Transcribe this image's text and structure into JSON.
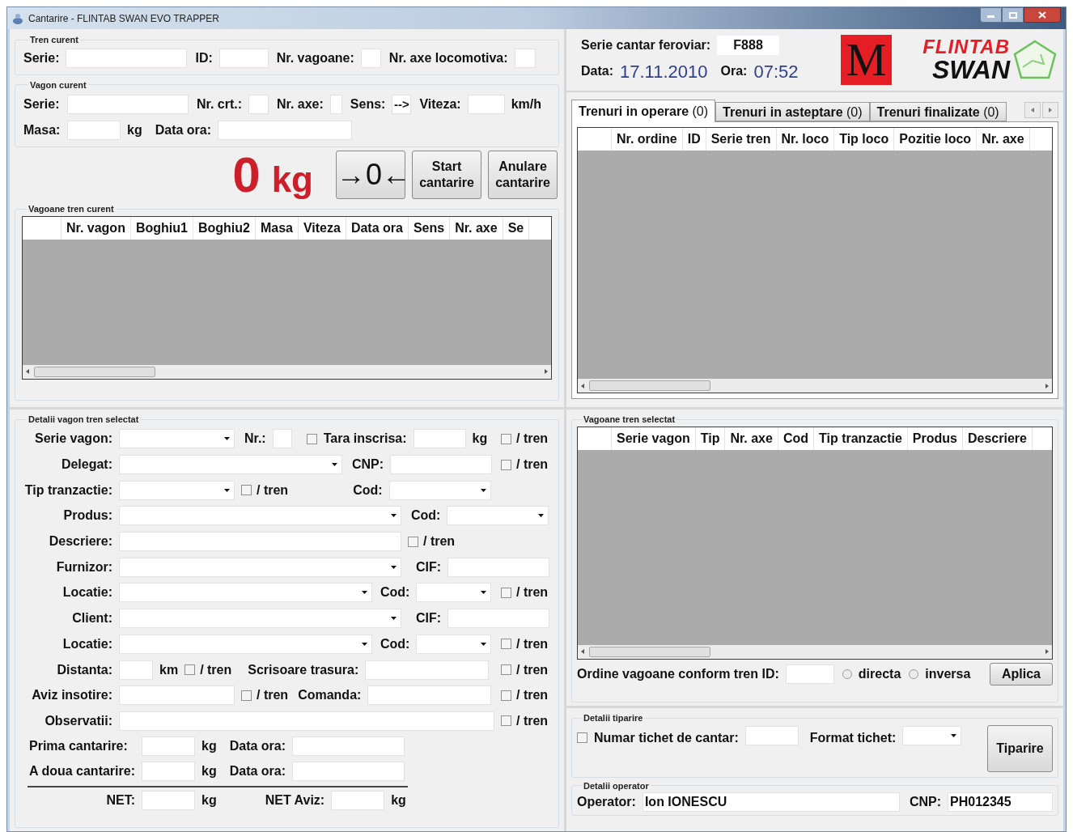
{
  "window": {
    "title": "Cantarire - FLINTAB SWAN EVO TRAPPER"
  },
  "tren_curent": {
    "title": "Tren curent",
    "rows": [
      [
        {
          "kind": "label",
          "text": "Serie:"
        },
        {
          "kind": "field"
        },
        {
          "kind": "label",
          "text": "ID:"
        },
        {
          "kind": "field"
        },
        {
          "kind": "label",
          "text": "Nr. vagoane:"
        },
        {
          "kind": "field"
        },
        {
          "kind": "label",
          "text": "Nr. axe locomotiva:"
        },
        {
          "kind": "field"
        }
      ]
    ]
  },
  "vagon_curent": {
    "title": "Vagon curent",
    "rows": [
      [
        {
          "kind": "label",
          "text": "Serie:"
        },
        {
          "kind": "field"
        },
        {
          "kind": "label",
          "text": "Nr. crt.:"
        },
        {
          "kind": "field"
        },
        {
          "kind": "label",
          "text": "Nr. axe:"
        },
        {
          "kind": "field"
        },
        {
          "kind": "label",
          "text": "Sens:"
        },
        {
          "kind": "field",
          "value": "-->"
        },
        {
          "kind": "label",
          "text": "Viteza:"
        },
        {
          "kind": "field"
        },
        {
          "kind": "unit",
          "text": "km/h"
        }
      ],
      [
        {
          "kind": "label",
          "text": "Masa:"
        },
        {
          "kind": "field"
        },
        {
          "kind": "unit",
          "text": "kg"
        },
        {
          "kind": "label",
          "text": "Data ora:"
        },
        {
          "kind": "field"
        }
      ]
    ]
  },
  "cantarire": {
    "value": "0",
    "unit": "kg",
    "buttons": [
      {
        "kind": "zero",
        "label": "→0←"
      },
      {
        "kind": "action",
        "label": "Start cantarire"
      },
      {
        "kind": "action",
        "label": "Anulare cantarire"
      }
    ]
  },
  "vagoane_tren_curent": {
    "title": "Vagoane tren curent",
    "columns": [
      "Nr. vagon",
      "Boghiu1",
      "Boghiu2",
      "Masa",
      "Viteza",
      "Data ora",
      "Sens",
      "Nr. axe",
      "Se"
    ]
  },
  "cantar": {
    "serie_label": "Serie cantar feroviar:",
    "serie": "F888",
    "data_label": "Data:",
    "data": "17.11.2010",
    "ora_label": "Ora:",
    "ora": "07:52"
  },
  "brand": {
    "mark": "M",
    "line_1": "FLINTAB",
    "line_2": "SWAN"
  },
  "tabs": [
    {
      "label": "**Trenuri in operare** (0)",
      "selected": true
    },
    {
      "label": "**Trenuri in asteptare** (0)",
      "selected": false
    },
    {
      "label": "**Trenuri finalizate** (0)",
      "selected": false
    }
  ],
  "trenuri_table": {
    "columns": [
      "Nr. ordine",
      "ID",
      "Serie tren",
      "Nr. loco",
      "Tip loco",
      "Pozitie loco",
      "Nr. axe"
    ]
  },
  "detalii_vagon": {
    "title": "Detalii vagon tren selectat",
    "rows": [
      {
        "items": [
          {
            "kind": "label",
            "text": "Serie vagon:"
          },
          {
            "kind": "combo"
          },
          {
            "kind": "label",
            "text": "Nr.:"
          },
          {
            "kind": "field"
          },
          {
            "kind": "check",
            "checked": false
          },
          {
            "kind": "label",
            "text": "Tara inscrisa:"
          },
          {
            "kind": "field"
          },
          {
            "kind": "unit",
            "text": "kg"
          }
        ],
        "tren": {
          "checked": false,
          "label": "/ tren"
        }
      },
      {
        "items": [
          {
            "kind": "label",
            "text": "Delegat:"
          },
          {
            "kind": "combo"
          },
          {
            "kind": "label",
            "text": "CNP:"
          },
          {
            "kind": "field"
          }
        ],
        "tren": {
          "checked": false,
          "label": "/ tren"
        }
      },
      {
        "items": [
          {
            "kind": "label",
            "text": "Tip tranzactie:"
          },
          {
            "kind": "combo"
          },
          {
            "kind": "check",
            "checked": false,
            "label": "/ tren"
          },
          {
            "kind": "label",
            "text": "Cod:"
          },
          {
            "kind": "combo"
          }
        ]
      },
      {
        "items": [
          {
            "kind": "label",
            "text": "Produs:"
          },
          {
            "kind": "combo"
          },
          {
            "kind": "label",
            "text": "Cod:"
          },
          {
            "kind": "combo"
          }
        ]
      },
      {
        "items": [
          {
            "kind": "label",
            "text": "Descriere:"
          },
          {
            "kind": "field"
          },
          {
            "kind": "check",
            "checked": false,
            "label": "/ tren"
          }
        ]
      },
      {
        "items": [
          {
            "kind": "label",
            "text": "Furnizor:"
          },
          {
            "kind": "combo"
          },
          {
            "kind": "label",
            "text": "CIF:"
          },
          {
            "kind": "field"
          }
        ]
      },
      {
        "items": [
          {
            "kind": "label",
            "text": "Locatie:"
          },
          {
            "kind": "combo"
          },
          {
            "kind": "label",
            "text": "Cod:"
          },
          {
            "kind": "combo"
          }
        ],
        "tren": {
          "checked": false,
          "label": "/ tren"
        }
      },
      {
        "items": [
          {
            "kind": "label",
            "text": "Client:"
          },
          {
            "kind": "combo"
          },
          {
            "kind": "label",
            "text": "CIF:"
          },
          {
            "kind": "field"
          }
        ]
      },
      {
        "items": [
          {
            "kind": "label",
            "text": "Locatie:"
          },
          {
            "kind": "combo"
          },
          {
            "kind": "label",
            "text": "Cod:"
          },
          {
            "kind": "combo"
          }
        ],
        "tren": {
          "checked": false,
          "label": "/ tren"
        }
      },
      {
        "items": [
          {
            "kind": "label",
            "text": "Distanta:"
          },
          {
            "kind": "field"
          },
          {
            "kind": "unit",
            "text": "km"
          },
          {
            "kind": "check",
            "checked": false,
            "label": "/ tren"
          },
          {
            "kind": "label",
            "text": "Scrisoare trasura:"
          },
          {
            "kind": "field"
          }
        ],
        "tren": {
          "checked": false,
          "label": "/ tren"
        }
      },
      {
        "items": [
          {
            "kind": "label",
            "text": "Aviz insotire:"
          },
          {
            "kind": "field"
          },
          {
            "kind": "check",
            "checked": false,
            "label": "/ tren"
          },
          {
            "kind": "label",
            "text": "Comanda:"
          },
          {
            "kind": "field"
          }
        ],
        "tren": {
          "checked": false,
          "label": "/ tren"
        }
      },
      {
        "items": [
          {
            "kind": "label",
            "text": "Observatii:"
          },
          {
            "kind": "field"
          }
        ],
        "tren": {
          "checked": false,
          "label": "/ tren"
        }
      }
    ],
    "weighings": [
      [
        {
          "kind": "label",
          "text": "Prima cantarire:"
        },
        {
          "kind": "field"
        },
        {
          "kind": "unit",
          "text": "kg"
        },
        {
          "kind": "label",
          "text": "Data ora:"
        },
        {
          "kind": "field"
        }
      ],
      [
        {
          "kind": "label",
          "text": "A doua cantarire:"
        },
        {
          "kind": "field"
        },
        {
          "kind": "unit",
          "text": "kg"
        },
        {
          "kind": "label",
          "text": "Data ora:"
        },
        {
          "kind": "field"
        }
      ]
    ],
    "net": [
      [
        {
          "kind": "label",
          "text": "NET:"
        },
        {
          "kind": "field"
        },
        {
          "kind": "unit",
          "text": "kg"
        },
        {
          "kind": "label",
          "text": "NET Aviz:"
        },
        {
          "kind": "field"
        },
        {
          "kind": "unit",
          "text": "kg"
        }
      ]
    ]
  },
  "vagoane_tren_selectat": {
    "title": "Vagoane tren selectat",
    "columns": [
      "Serie vagon",
      "Tip",
      "Nr. axe",
      "Cod",
      "Tip tranzactie",
      "Produs",
      "Descriere"
    ]
  },
  "ordine": {
    "label": "Ordine vagoane conform tren ID:",
    "options": [
      {
        "label": "directa",
        "selected": false
      },
      {
        "label": "inversa",
        "selected": false
      }
    ],
    "button": "Aplica"
  },
  "detalii_tiparire": {
    "title": "Detalii tiparire",
    "numar": {
      "label": "Numar tichet de cantar:",
      "checked": false
    },
    "format_label": "Format tichet:",
    "button": "Tiparire"
  },
  "detalii_operator": {
    "title": "Detalii operator",
    "operator_label": "Operator:",
    "operator": "Ion IONESCU",
    "cnp_label": "CNP:",
    "cnp": "PH012345"
  }
}
